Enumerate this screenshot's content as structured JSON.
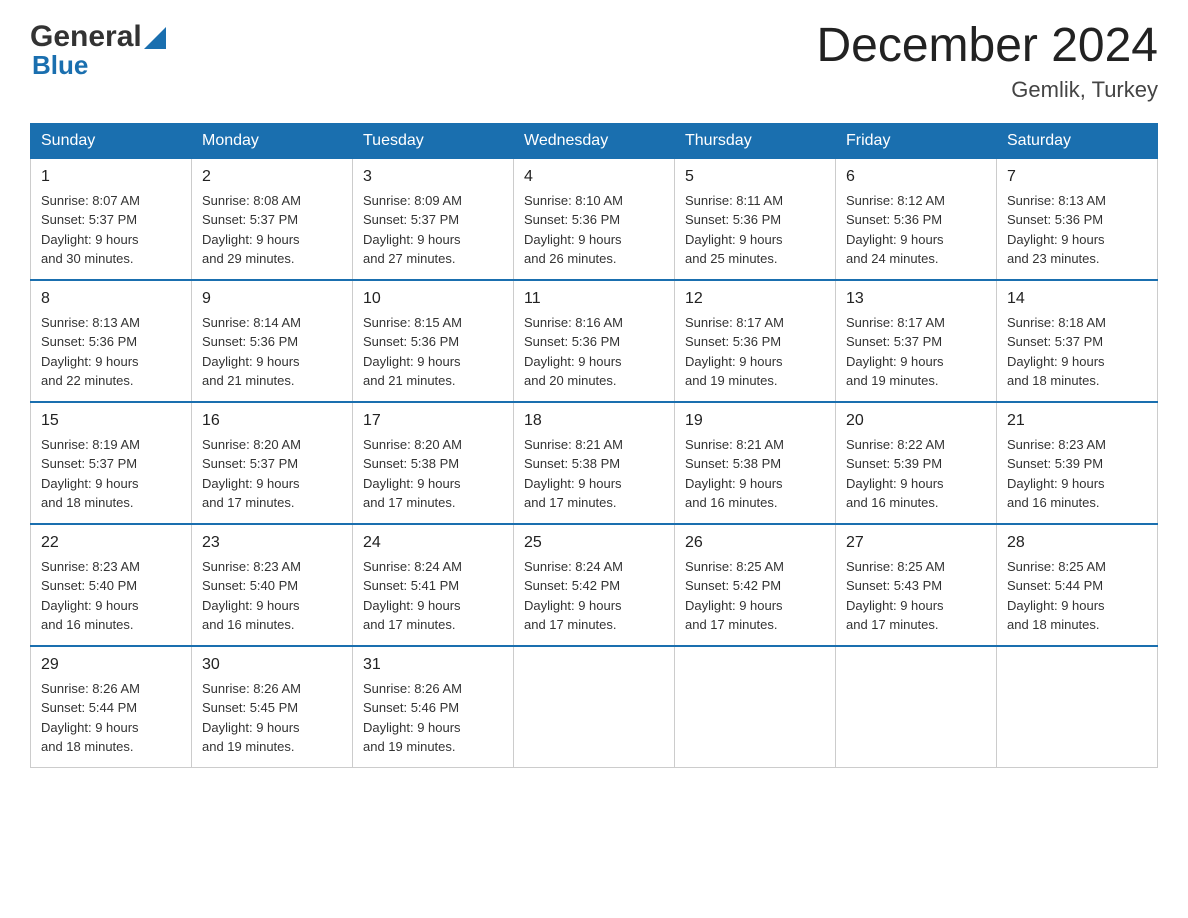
{
  "header": {
    "logo_general": "General",
    "logo_blue": "Blue",
    "title": "December 2024",
    "location": "Gemlik, Turkey"
  },
  "days_of_week": [
    "Sunday",
    "Monday",
    "Tuesday",
    "Wednesday",
    "Thursday",
    "Friday",
    "Saturday"
  ],
  "weeks": [
    [
      {
        "day": "1",
        "sunrise": "8:07 AM",
        "sunset": "5:37 PM",
        "daylight": "9 hours and 30 minutes."
      },
      {
        "day": "2",
        "sunrise": "8:08 AM",
        "sunset": "5:37 PM",
        "daylight": "9 hours and 29 minutes."
      },
      {
        "day": "3",
        "sunrise": "8:09 AM",
        "sunset": "5:37 PM",
        "daylight": "9 hours and 27 minutes."
      },
      {
        "day": "4",
        "sunrise": "8:10 AM",
        "sunset": "5:36 PM",
        "daylight": "9 hours and 26 minutes."
      },
      {
        "day": "5",
        "sunrise": "8:11 AM",
        "sunset": "5:36 PM",
        "daylight": "9 hours and 25 minutes."
      },
      {
        "day": "6",
        "sunrise": "8:12 AM",
        "sunset": "5:36 PM",
        "daylight": "9 hours and 24 minutes."
      },
      {
        "day": "7",
        "sunrise": "8:13 AM",
        "sunset": "5:36 PM",
        "daylight": "9 hours and 23 minutes."
      }
    ],
    [
      {
        "day": "8",
        "sunrise": "8:13 AM",
        "sunset": "5:36 PM",
        "daylight": "9 hours and 22 minutes."
      },
      {
        "day": "9",
        "sunrise": "8:14 AM",
        "sunset": "5:36 PM",
        "daylight": "9 hours and 21 minutes."
      },
      {
        "day": "10",
        "sunrise": "8:15 AM",
        "sunset": "5:36 PM",
        "daylight": "9 hours and 21 minutes."
      },
      {
        "day": "11",
        "sunrise": "8:16 AM",
        "sunset": "5:36 PM",
        "daylight": "9 hours and 20 minutes."
      },
      {
        "day": "12",
        "sunrise": "8:17 AM",
        "sunset": "5:36 PM",
        "daylight": "9 hours and 19 minutes."
      },
      {
        "day": "13",
        "sunrise": "8:17 AM",
        "sunset": "5:37 PM",
        "daylight": "9 hours and 19 minutes."
      },
      {
        "day": "14",
        "sunrise": "8:18 AM",
        "sunset": "5:37 PM",
        "daylight": "9 hours and 18 minutes."
      }
    ],
    [
      {
        "day": "15",
        "sunrise": "8:19 AM",
        "sunset": "5:37 PM",
        "daylight": "9 hours and 18 minutes."
      },
      {
        "day": "16",
        "sunrise": "8:20 AM",
        "sunset": "5:37 PM",
        "daylight": "9 hours and 17 minutes."
      },
      {
        "day": "17",
        "sunrise": "8:20 AM",
        "sunset": "5:38 PM",
        "daylight": "9 hours and 17 minutes."
      },
      {
        "day": "18",
        "sunrise": "8:21 AM",
        "sunset": "5:38 PM",
        "daylight": "9 hours and 17 minutes."
      },
      {
        "day": "19",
        "sunrise": "8:21 AM",
        "sunset": "5:38 PM",
        "daylight": "9 hours and 16 minutes."
      },
      {
        "day": "20",
        "sunrise": "8:22 AM",
        "sunset": "5:39 PM",
        "daylight": "9 hours and 16 minutes."
      },
      {
        "day": "21",
        "sunrise": "8:23 AM",
        "sunset": "5:39 PM",
        "daylight": "9 hours and 16 minutes."
      }
    ],
    [
      {
        "day": "22",
        "sunrise": "8:23 AM",
        "sunset": "5:40 PM",
        "daylight": "9 hours and 16 minutes."
      },
      {
        "day": "23",
        "sunrise": "8:23 AM",
        "sunset": "5:40 PM",
        "daylight": "9 hours and 16 minutes."
      },
      {
        "day": "24",
        "sunrise": "8:24 AM",
        "sunset": "5:41 PM",
        "daylight": "9 hours and 17 minutes."
      },
      {
        "day": "25",
        "sunrise": "8:24 AM",
        "sunset": "5:42 PM",
        "daylight": "9 hours and 17 minutes."
      },
      {
        "day": "26",
        "sunrise": "8:25 AM",
        "sunset": "5:42 PM",
        "daylight": "9 hours and 17 minutes."
      },
      {
        "day": "27",
        "sunrise": "8:25 AM",
        "sunset": "5:43 PM",
        "daylight": "9 hours and 17 minutes."
      },
      {
        "day": "28",
        "sunrise": "8:25 AM",
        "sunset": "5:44 PM",
        "daylight": "9 hours and 18 minutes."
      }
    ],
    [
      {
        "day": "29",
        "sunrise": "8:26 AM",
        "sunset": "5:44 PM",
        "daylight": "9 hours and 18 minutes."
      },
      {
        "day": "30",
        "sunrise": "8:26 AM",
        "sunset": "5:45 PM",
        "daylight": "9 hours and 19 minutes."
      },
      {
        "day": "31",
        "sunrise": "8:26 AM",
        "sunset": "5:46 PM",
        "daylight": "9 hours and 19 minutes."
      },
      null,
      null,
      null,
      null
    ]
  ],
  "labels": {
    "sunrise": "Sunrise:",
    "sunset": "Sunset:",
    "daylight": "Daylight:"
  },
  "colors": {
    "header_bg": "#1a6faf",
    "header_text": "#ffffff",
    "border_week": "#1a6faf",
    "border_cell": "#cccccc"
  }
}
